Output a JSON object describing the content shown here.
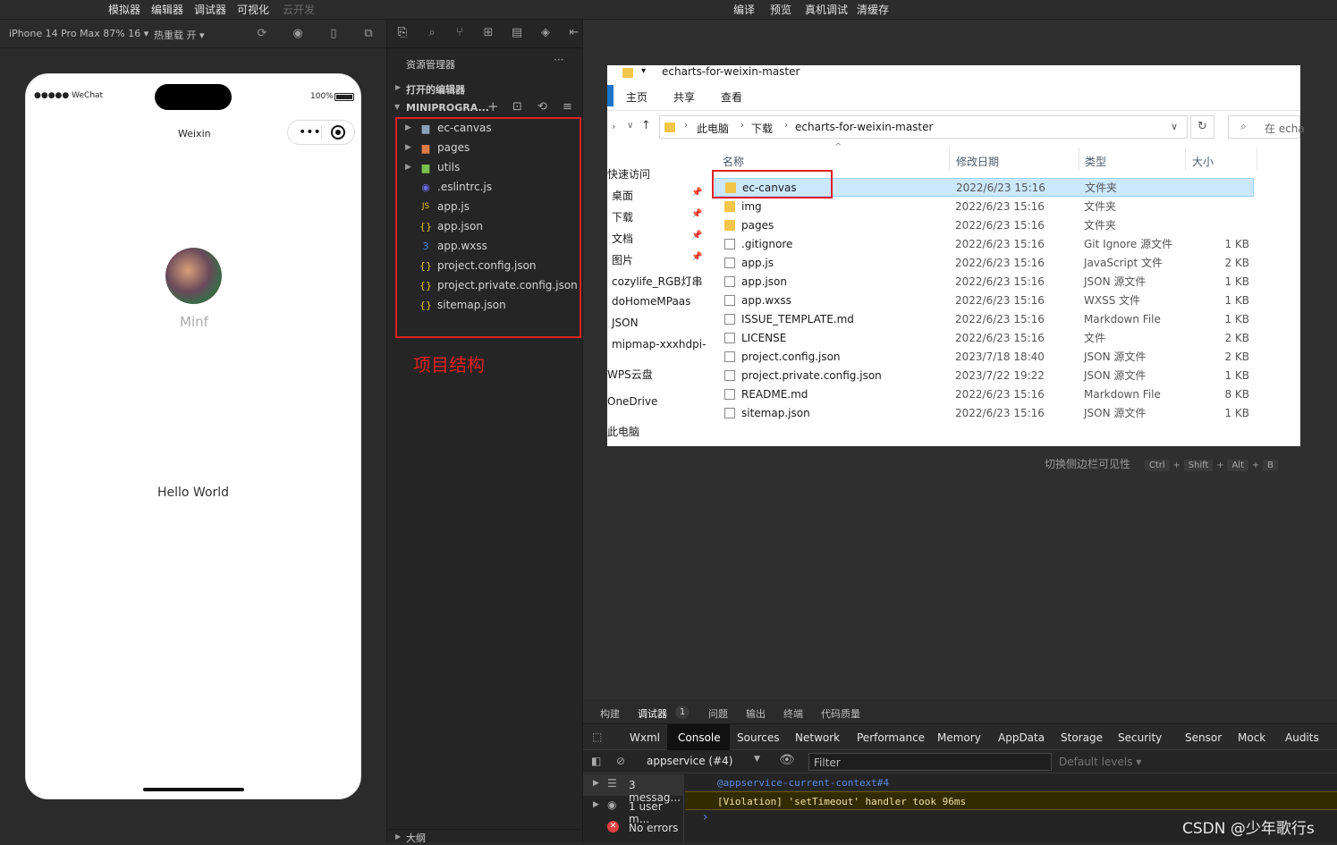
{
  "topbar": {
    "menus": [
      "模拟器",
      "编辑器",
      "调试器",
      "可视化",
      "云开发"
    ],
    "actions": [
      "编译",
      "预览",
      "真机调试",
      "清缓存"
    ]
  },
  "simulator": {
    "device": "iPhone 14 Pro Max 87% 16 ▾",
    "hot_reload": "热重载 开 ▾",
    "status_left": "●●●●● WeChat",
    "battery": "100%",
    "nav_title": "Weixin",
    "user_name": "Minf",
    "hello": "Hello World"
  },
  "explorer": {
    "title": "资源管理器",
    "open_editors": "打开的编辑器",
    "project": "MINIPROGRA...",
    "items": [
      {
        "label": "ec-canvas",
        "type": "folder"
      },
      {
        "label": "pages",
        "type": "folder"
      },
      {
        "label": "utils",
        "type": "folder"
      },
      {
        "label": ".eslintrc.js",
        "type": "eslint"
      },
      {
        "label": "app.js",
        "type": "js"
      },
      {
        "label": "app.json",
        "type": "json"
      },
      {
        "label": "app.wxss",
        "type": "wxss"
      },
      {
        "label": "project.config.json",
        "type": "json"
      },
      {
        "label": "project.private.config.json",
        "type": "json"
      },
      {
        "label": "sitemap.json",
        "type": "json"
      }
    ],
    "annotation": "项目结构",
    "outline": "大纲"
  },
  "file_explorer": {
    "title": "echarts-for-weixin-master",
    "ribbon": [
      "主页",
      "共享",
      "查看"
    ],
    "breadcrumb": [
      "此电脑",
      "下载",
      "echarts-for-weixin-master"
    ],
    "search_placeholder": "在 echa",
    "columns": {
      "name": "名称",
      "date": "修改日期",
      "type": "类型",
      "size": "大小"
    },
    "quick_access": [
      "快速访问",
      "桌面",
      "下载",
      "文档",
      "图片",
      "cozylife_RGB灯串",
      "doHomeMPaas",
      "JSON",
      "mipmap-xxxhdpi-",
      "WPS云盘",
      "OneDrive",
      "此电脑"
    ],
    "rows": [
      {
        "name": "ec-canvas",
        "date": "2022/6/23 15:16",
        "type": "文件夹",
        "size": "",
        "folder": true
      },
      {
        "name": "img",
        "date": "2022/6/23 15:16",
        "type": "文件夹",
        "size": "",
        "folder": true
      },
      {
        "name": "pages",
        "date": "2022/6/23 15:16",
        "type": "文件夹",
        "size": "",
        "folder": true
      },
      {
        "name": ".gitignore",
        "date": "2022/6/23 15:16",
        "type": "Git Ignore 源文件",
        "size": "1 KB",
        "folder": false
      },
      {
        "name": "app.js",
        "date": "2022/6/23 15:16",
        "type": "JavaScript 文件",
        "size": "2 KB",
        "folder": false
      },
      {
        "name": "app.json",
        "date": "2022/6/23 15:16",
        "type": "JSON 源文件",
        "size": "1 KB",
        "folder": false
      },
      {
        "name": "app.wxss",
        "date": "2022/6/23 15:16",
        "type": "WXSS 文件",
        "size": "1 KB",
        "folder": false
      },
      {
        "name": "ISSUE_TEMPLATE.md",
        "date": "2022/6/23 15:16",
        "type": "Markdown File",
        "size": "1 KB",
        "folder": false
      },
      {
        "name": "LICENSE",
        "date": "2022/6/23 15:16",
        "type": "文件",
        "size": "2 KB",
        "folder": false
      },
      {
        "name": "project.config.json",
        "date": "2023/7/18 18:40",
        "type": "JSON 源文件",
        "size": "2 KB",
        "folder": false
      },
      {
        "name": "project.private.config.json",
        "date": "2023/7/22 19:22",
        "type": "JSON 源文件",
        "size": "1 KB",
        "folder": false
      },
      {
        "name": "README.md",
        "date": "2022/6/23 15:16",
        "type": "Markdown File",
        "size": "8 KB",
        "folder": false
      },
      {
        "name": "sitemap.json",
        "date": "2022/6/23 15:16",
        "type": "JSON 源文件",
        "size": "1 KB",
        "folder": false
      }
    ]
  },
  "shortcut_hint": {
    "label": "切换侧边栏可见性",
    "keys": [
      "Ctrl",
      "+",
      "Shift",
      "+",
      "Alt",
      "+",
      "B"
    ]
  },
  "devtools": {
    "top_tabs": [
      "构建",
      "调试器",
      "问题",
      "输出",
      "终端",
      "代码质量"
    ],
    "badge": "1",
    "tabs": [
      "Wxml",
      "Console",
      "Sources",
      "Network",
      "Performance",
      "Memory",
      "AppData",
      "Storage",
      "Security",
      "Sensor",
      "Mock",
      "Audits"
    ],
    "context": "appservice (#4)",
    "filter_placeholder": "Filter",
    "levels": "Default levels ▾",
    "side": [
      "3 messag...",
      "1 user m...",
      "No errors"
    ],
    "log_context": "@appservice-current-context#4",
    "log_violation": "[Violation] 'setTimeout' handler took 96ms",
    "prompt": "›"
  },
  "watermark": "CSDN @少年歌行s"
}
